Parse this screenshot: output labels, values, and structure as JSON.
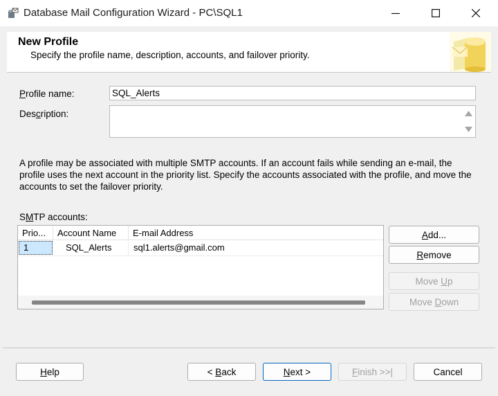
{
  "window": {
    "title": "Database Mail Configuration Wizard - PC\\SQL1",
    "controls": {
      "minimize_icon": "minimize-icon",
      "maximize_icon": "maximize-icon",
      "close_icon": "close-icon"
    }
  },
  "header": {
    "title": "New Profile",
    "subtitle": "Specify the profile name, description, accounts, and failover priority."
  },
  "form": {
    "profile_name": {
      "label_pre": "",
      "label_key": "P",
      "label_post": "rofile name:",
      "value": "SQL_Alerts"
    },
    "description": {
      "label_pre": "Des",
      "label_key": "c",
      "label_post": "ription:",
      "value": ""
    }
  },
  "info_text": "A profile may be associated with multiple SMTP accounts. If an account fails while sending an e-mail, the profile uses the next account in the priority list. Specify the accounts associated with the profile, and move the accounts to set the failover priority.",
  "smtp": {
    "label_pre": "S",
    "label_key": "M",
    "label_post": "TP accounts:",
    "columns": [
      "Prio...",
      "Account Name",
      "E-mail Address"
    ],
    "rows": [
      {
        "priority": "1",
        "account_name": "SQL_Alerts",
        "email": "sql1.alerts@gmail.com"
      }
    ]
  },
  "side_buttons": {
    "add": {
      "key": "A",
      "rest": "dd...",
      "enabled": true
    },
    "remove": {
      "key": "R",
      "rest": "emove",
      "enabled": true
    },
    "move_up": {
      "pre": "Move ",
      "key": "U",
      "rest": "p",
      "enabled": false
    },
    "move_down": {
      "pre": "Move ",
      "key": "D",
      "rest": "own",
      "enabled": false
    }
  },
  "footer": {
    "help": {
      "key": "H",
      "rest": "elp"
    },
    "back": {
      "pre": "< ",
      "key": "B",
      "rest": "ack"
    },
    "next": {
      "key": "N",
      "rest": "ext >"
    },
    "finish": {
      "key": "F",
      "rest": "inish >>|"
    },
    "cancel": "Cancel"
  },
  "colors": {
    "selection": "#cce8ff",
    "accent_border": "#0067c0",
    "disabled_text": "#a0a0a0"
  }
}
